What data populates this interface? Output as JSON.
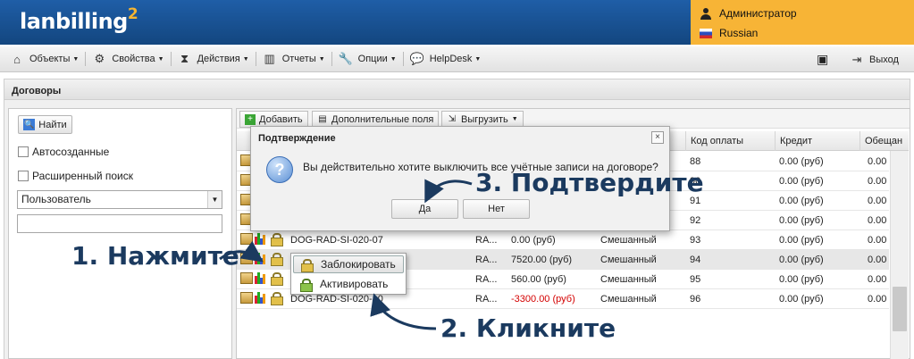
{
  "header": {
    "logo_text": "lanbilling",
    "logo_sup": "2",
    "user_label": "Администратор",
    "language_label": "Russian"
  },
  "menu": {
    "items": [
      "Объекты",
      "Свойства",
      "Действия",
      "Отчеты",
      "Опции",
      "HelpDesk"
    ],
    "logout_label": "Выход"
  },
  "panel": {
    "title": "Договоры"
  },
  "left": {
    "find_button": "Найти",
    "auto_created_label": "Автосозданные",
    "extended_search_label": "Расширенный поиск",
    "search_by_value": "Пользователь",
    "search_value": ""
  },
  "toolbar": {
    "add_label": "Добавить",
    "extra_fields_label": "Дополнительные поля",
    "export_label": "Выгрузить"
  },
  "columns": [
    "Код оплаты",
    "Кредит",
    "Обещан"
  ],
  "rows": [
    {
      "name": "",
      "agent": "",
      "balance": "",
      "type": "",
      "code": "88",
      "credit": "0.00 (руб)",
      "promised": "0.00"
    },
    {
      "name": "",
      "agent": "",
      "balance": "",
      "type": "",
      "code": "90",
      "credit": "0.00 (руб)",
      "promised": "0.00"
    },
    {
      "name": "",
      "agent": "",
      "balance": "",
      "type": "",
      "code": "91",
      "credit": "0.00 (руб)",
      "promised": "0.00"
    },
    {
      "name": "",
      "agent": "",
      "balance": "",
      "type": "",
      "code": "92",
      "credit": "0.00 (руб)",
      "promised": "0.00"
    },
    {
      "name": "DOG-RAD-SI-020-07",
      "agent": "RA...",
      "balance": "0.00 (руб)",
      "type": "Смешанный",
      "code": "93",
      "credit": "0.00 (руб)",
      "promised": "0.00"
    },
    {
      "name": "",
      "agent": "RA...",
      "balance": "7520.00 (руб)",
      "type": "Смешанный",
      "code": "94",
      "credit": "0.00 (руб)",
      "promised": "0.00"
    },
    {
      "name": "",
      "agent": "RA...",
      "balance": "560.00 (руб)",
      "type": "Смешанный",
      "code": "95",
      "credit": "0.00 (руб)",
      "promised": "0.00"
    },
    {
      "name": "DOG-RAD-SI-020-10",
      "agent": "RA...",
      "balance": "-3300.00 (руб)",
      "type": "Смешанный",
      "code": "96",
      "credit": "0.00 (руб)",
      "promised": "0.00"
    }
  ],
  "dialog": {
    "title": "Подтверждение",
    "message": "Вы действительно хотите выключить все учётные записи на договоре?",
    "yes_label": "Да",
    "no_label": "Нет",
    "close_glyph": "×",
    "question_glyph": "?"
  },
  "context_menu": {
    "block_label": "Заблокировать",
    "activate_label": "Активировать"
  },
  "callouts": {
    "step1": "1. Нажмите",
    "step2": "2. Кликните",
    "step3": "3. Подтвердите"
  },
  "colors": {
    "header_blue": "#1a5598",
    "user_box": "#f7b436",
    "callout_text": "#1b3a5f",
    "negative": "#d40000"
  }
}
